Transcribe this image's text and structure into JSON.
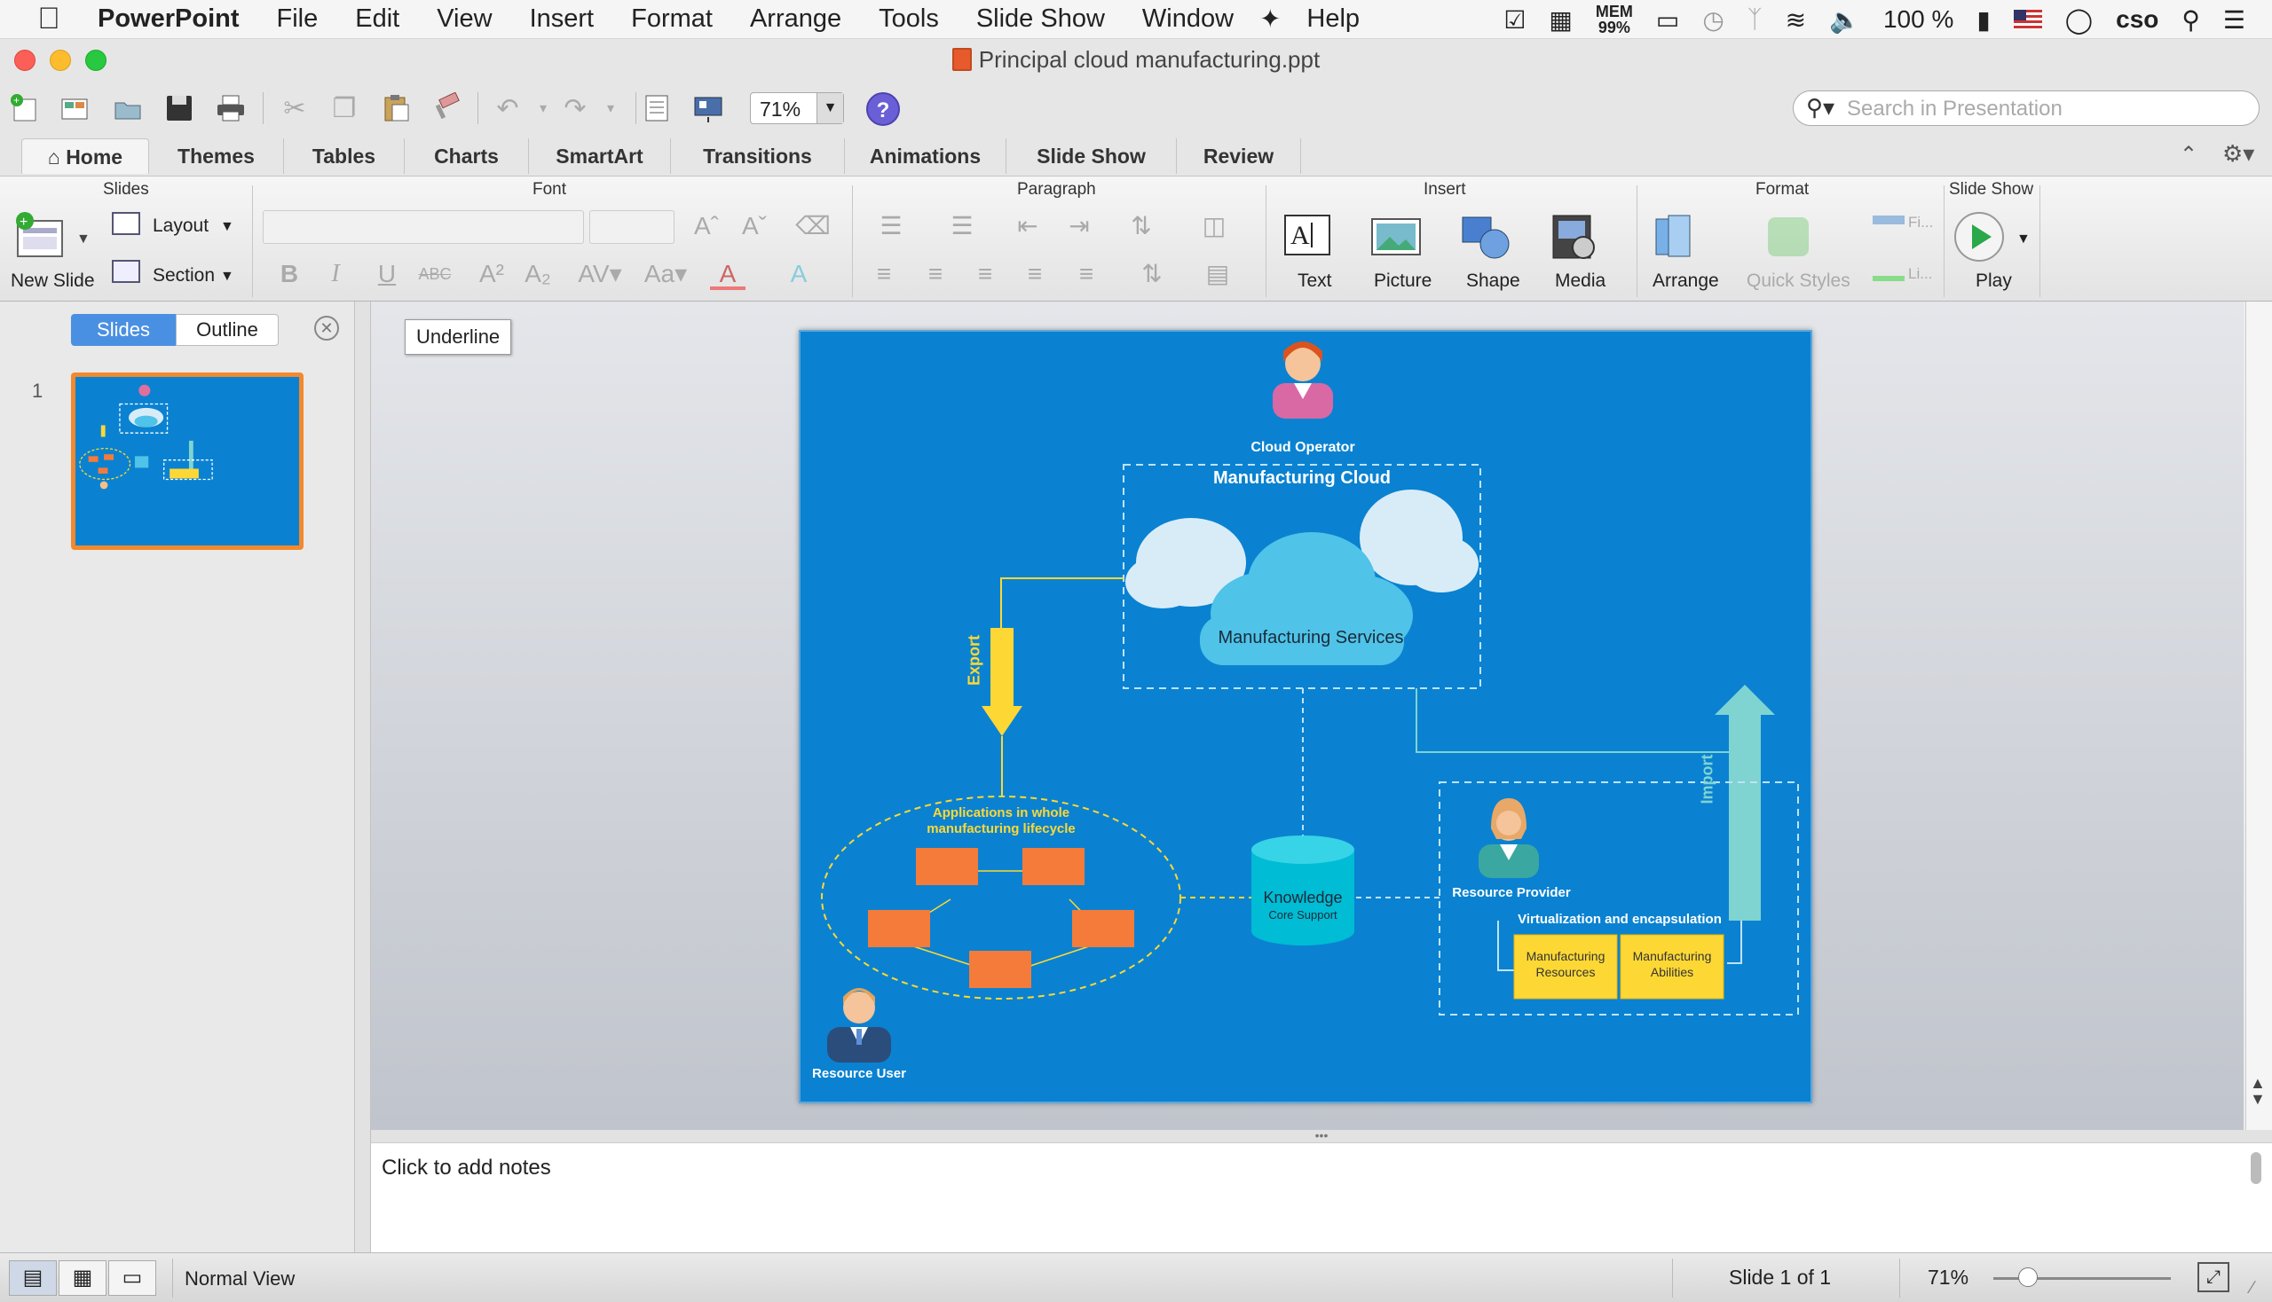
{
  "menubar": {
    "app_name": "PowerPoint",
    "items": [
      "File",
      "Edit",
      "View",
      "Insert",
      "Format",
      "Arrange",
      "Tools",
      "Slide Show",
      "Window",
      "Help"
    ],
    "mem_label": "MEM",
    "mem_value": "99%",
    "battery": "100 %",
    "user": "cso"
  },
  "window": {
    "title": "Principal cloud manufacturing.ppt"
  },
  "toolbar": {
    "zoom": "71%",
    "help_symbol": "?",
    "search_placeholder": "Search in Presentation"
  },
  "ribbon_tabs": [
    "Home",
    "Themes",
    "Tables",
    "Charts",
    "SmartArt",
    "Transitions",
    "Animations",
    "Slide Show",
    "Review"
  ],
  "ribbon": {
    "groups": {
      "slides": "Slides",
      "font": "Font",
      "paragraph": "Paragraph",
      "insert": "Insert",
      "format": "Format",
      "slideshow": "Slide Show"
    },
    "new_slide": "New Slide",
    "layout": "Layout",
    "section": "Section",
    "text": "Text",
    "picture": "Picture",
    "shape": "Shape",
    "media": "Media",
    "arrange": "Arrange",
    "quick_styles": "Quick Styles",
    "fill_short": "Fi...",
    "line_short": "Li...",
    "play": "Play"
  },
  "left_pane": {
    "tab_slides": "Slides",
    "tab_outline": "Outline",
    "slide_number": "1"
  },
  "tooltip": "Underline",
  "slide": {
    "cloud_operator": "Cloud Operator",
    "manufacturing_cloud": "Manufacturing Cloud",
    "manufacturing_services": "Manufacturing Services",
    "export": "Export",
    "import": "Import",
    "applications_line1": "Applications in whole",
    "applications_line2": "manufacturing lifecycle",
    "knowledge": "Knowledge",
    "core_support": "Core Support",
    "resource_provider": "Resource Provider",
    "virtualization": "Virtualization and encapsulation",
    "mfg_resources_1": "Manufacturing",
    "mfg_resources_2": "Resources",
    "mfg_abilities_1": "Manufacturing",
    "mfg_abilities_2": "Abilities",
    "resource_user": "Resource User"
  },
  "notes": {
    "placeholder": "Click to add notes"
  },
  "statusbar": {
    "view_name": "Normal View",
    "slide_of": "Slide 1 of 1",
    "zoom": "71%"
  },
  "colors": {
    "slide_bg": "#0a82d1",
    "orange_box": "#f47b3a",
    "yellow_box": "#fdd835",
    "cloud": "#4fc3e8",
    "thumb_border": "#f2892e",
    "accent_tab": "#4a90e2"
  }
}
